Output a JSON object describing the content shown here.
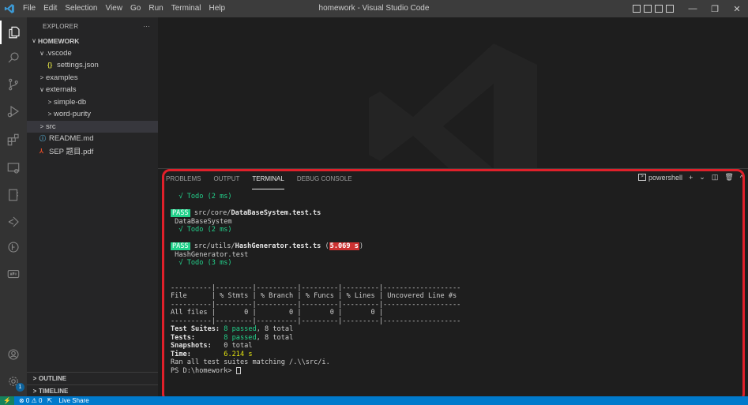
{
  "titlebar": {
    "menu": [
      "File",
      "Edit",
      "Selection",
      "View",
      "Go",
      "Run",
      "Terminal",
      "Help"
    ],
    "title": "homework - Visual Studio Code",
    "minimize": "—",
    "maximize": "❐",
    "close": "✕"
  },
  "sidebar": {
    "title": "EXPLORER",
    "more": "···",
    "workspace": "HOMEWORK",
    "items": [
      {
        "label": ".vscode",
        "chev": "∨"
      },
      {
        "label": "settings.json",
        "icon": "{}"
      },
      {
        "label": "examples",
        "chev": ">"
      },
      {
        "label": "externals",
        "chev": "∨"
      },
      {
        "label": "simple-db",
        "chev": ">"
      },
      {
        "label": "word-purity",
        "chev": ">"
      },
      {
        "label": "src",
        "chev": ">"
      },
      {
        "label": "README.md",
        "icon": "ⓘ"
      },
      {
        "label": "SEP 题目.pdf",
        "icon": "⅄"
      }
    ],
    "outline": "OUTLINE",
    "timeline": "TIMELINE"
  },
  "panel": {
    "tabs": [
      "PROBLEMS",
      "OUTPUT",
      "TERMINAL",
      "DEBUG CONSOLE"
    ],
    "shell": "powershell"
  },
  "terminal": {
    "l1": "  √ Todo (2 ms)",
    "pass": "PASS",
    "s1_path": "src/core/",
    "s1_file": "DataBaseSystem.test.ts",
    "s1_suite": " DataBaseSystem",
    "s1_todo": "  √ Todo (2 ms)",
    "s2_path": "src/utils/",
    "s2_file": "HashGenerator.test.ts",
    "s2_time": "5.069 s",
    "s2_suite": " HashGenerator.test",
    "s2_todo": "  √ Todo (3 ms)",
    "sep": "----------|---------|----------|---------|---------|-------------------",
    "header": "File      | % Stmts | % Branch | % Funcs | % Lines | Uncovered Line #s",
    "allfiles": "All files |       0 |        0 |       0 |       0 |",
    "suites_label": "Test Suites:",
    "suites_passed": "8 passed",
    "suites_total": ", 8 total",
    "tests_label": "Tests:",
    "tests_passed": "8 passed",
    "tests_total": ", 8 total",
    "snap_label": "Snapshots:",
    "snap_val": "0 total",
    "time_label": "Time:",
    "time_val": "6.214 s",
    "ran": "Ran all test suites matching /.\\\\src/i.",
    "prompt": "PS D:\\homework> "
  },
  "status": {
    "problems": "⊗ 0 ⚠ 0",
    "liveshare": "Live Share"
  },
  "colors": {
    "accent": "#007acc",
    "pass": "#23d18b",
    "highlight": "#e0202a"
  }
}
